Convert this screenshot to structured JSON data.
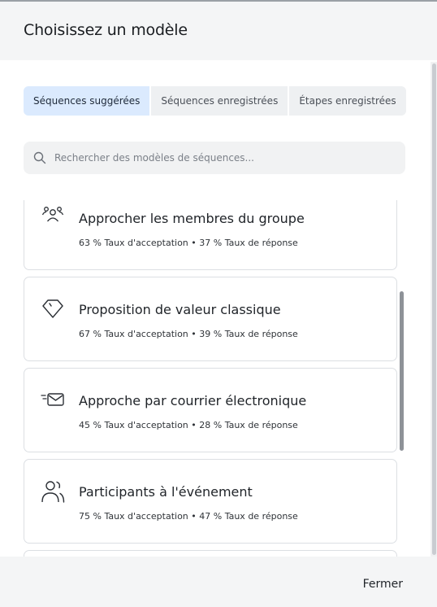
{
  "modal": {
    "title": "Choisissez un modèle",
    "close_label": "Fermer"
  },
  "tabs": [
    {
      "label": "Séquences suggérées",
      "active": true
    },
    {
      "label": "Séquences enregistrées",
      "active": false
    },
    {
      "label": "Étapes enregistrées",
      "active": false
    }
  ],
  "search": {
    "placeholder": "Rechercher des modèles de séquences...",
    "value": "",
    "icon": "search-icon"
  },
  "templates": [
    {
      "title": "Approcher les membres du groupe",
      "stats": "63 % Taux d'acceptation • 37 % Taux de réponse",
      "icon": "group-icon"
    },
    {
      "title": "Proposition de valeur classique",
      "stats": "67 % Taux d'acceptation • 39 % Taux de réponse",
      "icon": "diamond-icon"
    },
    {
      "title": "Approche par courrier électronique",
      "stats": "45 % Taux d'acceptation • 28 % Taux de réponse",
      "icon": "envelope-icon"
    },
    {
      "title": "Participants à l'événement",
      "stats": "75 % Taux d'acceptation • 47 % Taux de réponse",
      "icon": "people-icon"
    }
  ],
  "colors": {
    "active_tab": "#dbeafe",
    "header_bg": "#f4f5f6",
    "card_border": "#dcdfe3"
  }
}
